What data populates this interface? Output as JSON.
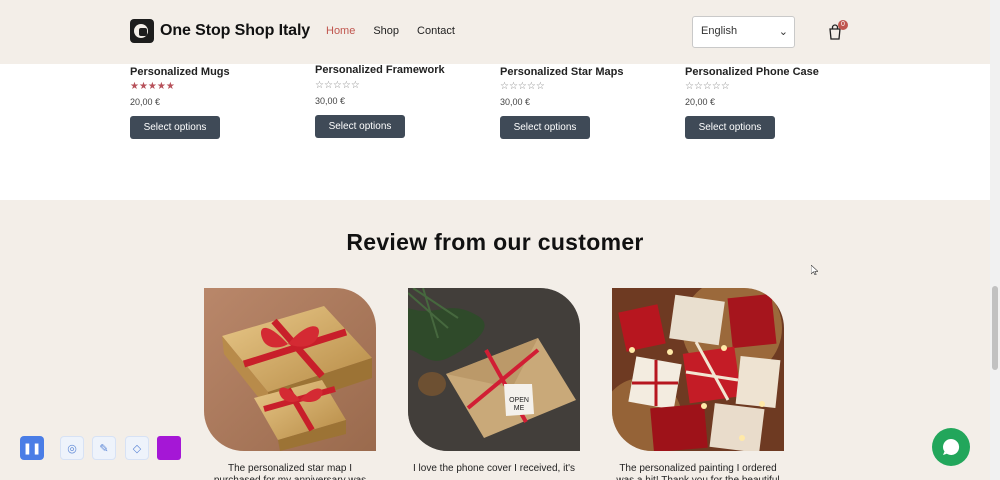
{
  "header": {
    "brand": "One Stop Shop Italy",
    "nav": [
      {
        "label": "Home",
        "active": true
      },
      {
        "label": "Shop",
        "active": false
      },
      {
        "label": "Contact",
        "active": false
      }
    ],
    "language": "English",
    "cart_count": "0"
  },
  "products": [
    {
      "name": "Personalized Mugs",
      "rating": 5,
      "price": "20,00 €",
      "button": "Select options"
    },
    {
      "name": "Personalized Framework",
      "rating": 0,
      "price": "30,00 €",
      "button": "Select options"
    },
    {
      "name": "Personalized Star Maps",
      "rating": 0,
      "price": "30,00 €",
      "button": "Select options"
    },
    {
      "name": "Personalized Phone Case",
      "rating": 0,
      "price": "20,00 €",
      "button": "Select options"
    }
  ],
  "reviews": {
    "title": "Review from our customer",
    "cards": [
      {
        "text": "The personalized star map I purchased for my anniversary was"
      },
      {
        "text": "I love the phone cover I received, it's"
      },
      {
        "text": "The personalized painting I ordered was a hit! Thank you for the beautiful"
      }
    ]
  },
  "colors": {
    "accent": "#c0564f",
    "button": "#3f4a57",
    "background": "#f3eee8",
    "chat": "#22a65b",
    "toolbar_pause": "#4a7de6",
    "toolbar_color": "#a517d6"
  },
  "icons": {
    "cart": "cart-icon",
    "chat": "chat-icon",
    "toolbar": [
      "pause-icon",
      "fingerprint-icon",
      "pen-icon",
      "eraser-icon",
      "color-swatch-icon"
    ]
  }
}
